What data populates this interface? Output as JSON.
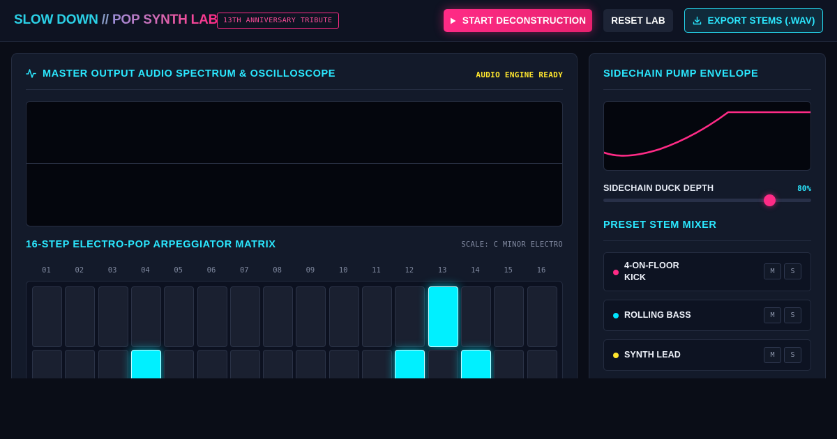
{
  "header": {
    "brand_part1": "SLOW DOWN",
    "brand_sep": " // ",
    "brand_part2": "POP SYNTH LAB",
    "anniversary_badge": "13TH ANNIVERSARY TRIBUTE",
    "start_button": "START DECONSTRUCTION",
    "reset_button": "RESET LAB",
    "export_button": "EXPORT STEMS (.WAV)"
  },
  "spectrum": {
    "title": "MASTER OUTPUT AUDIO SPECTRUM & OSCILLOSCOPE",
    "status": "AUDIO ENGINE READY"
  },
  "arpeggiator": {
    "title": "16-STEP ELECTRO-POP ARPEGGIATOR MATRIX",
    "scale": "SCALE: C MINOR ELECTRO",
    "steps": [
      "01",
      "02",
      "03",
      "04",
      "05",
      "06",
      "07",
      "08",
      "09",
      "10",
      "11",
      "12",
      "13",
      "14",
      "15",
      "16"
    ],
    "active_row1": [
      13
    ],
    "active_row2": [
      4,
      12,
      14
    ]
  },
  "sidechain": {
    "title": "SIDECHAIN PUMP ENVELOPE",
    "duck_label": "SIDECHAIN DUCK DEPTH",
    "duck_value": "80%",
    "duck_fraction": 0.8
  },
  "mixer": {
    "title": "PRESET STEM MIXER",
    "stems": [
      {
        "line1": "4-ON-FLOOR",
        "line2": "KICK",
        "color": "#ff2b86",
        "mute": "M",
        "solo": "S"
      },
      {
        "line1": "ROLLING BASS",
        "line2": "",
        "color": "#00e5ff",
        "mute": "M",
        "solo": "S"
      },
      {
        "line1": "SYNTH LEAD",
        "line2": "",
        "color": "#ffe62e",
        "mute": "M",
        "solo": "S"
      }
    ]
  },
  "colors": {
    "accent_pink": "#ff2b86",
    "accent_cyan": "#00f0ff",
    "accent_yellow": "#ffe62e"
  }
}
